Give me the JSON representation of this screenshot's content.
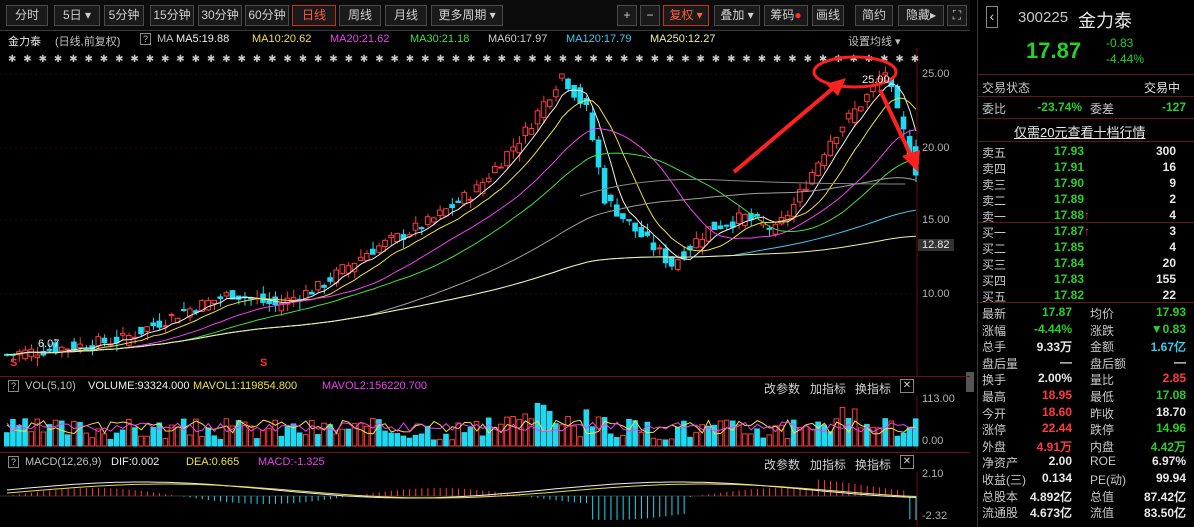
{
  "toolbar": {
    "tabs": [
      "分时",
      "5日",
      "5分钟",
      "15分钟",
      "30分钟",
      "60分钟",
      "日线",
      "周线",
      "月线",
      "更多周期"
    ],
    "active_tab": "日线",
    "plus": "+",
    "minus": "−",
    "fuquan": "复权",
    "diejia": "叠加",
    "chouma": "筹码",
    "huaxian": "画线",
    "jianyue": "简约",
    "yincang": "隐藏"
  },
  "legend": {
    "name": "金力泰",
    "mode": "(日线,前复权)",
    "ma": "MA",
    "ma5": "MA5:19.88",
    "ma10": "MA10:20.62",
    "ma20": "MA20:21.62",
    "ma30": "MA30:21.18",
    "ma60": "MA60:17.97",
    "ma120": "MA120:17.79",
    "ma250": "MA250:12.27",
    "settings": "设置均线"
  },
  "price_axis": [
    "25.00",
    "20.00",
    "15.00",
    "12.82",
    "10.00"
  ],
  "chart_labels": {
    "high": "25.00",
    "low": "6.07"
  },
  "volume": {
    "title": "VOL(5,10)",
    "volume": "VOLUME:93324.000",
    "mavol1": "MAVOL1:119854.800",
    "mavol2": "MAVOL2:156220.700",
    "axis": [
      "113.00",
      "0.00"
    ]
  },
  "macd": {
    "title": "MACD(12,26,9)",
    "dif": "DIF:0.002",
    "dea": "DEA:0.665",
    "macd": "MACD:-1.325",
    "axis": [
      "2.10",
      "-2.32"
    ]
  },
  "panel_buttons": {
    "change": "改参数",
    "add": "加指标",
    "swap": "换指标"
  },
  "quote": {
    "code": "300225",
    "name": "金力泰",
    "price": "17.87",
    "change": "-0.83",
    "pct": "-4.44%",
    "status_label": "交易状态",
    "status": "交易中",
    "weibi_label": "委比",
    "weibi": "-23.74%",
    "weicha_label": "委差",
    "weicha": "-127",
    "link": "仅需20元查看十档行情",
    "sells": [
      {
        "l": "卖五",
        "p": "17.93",
        "v": "300"
      },
      {
        "l": "卖四",
        "p": "17.91",
        "v": "16"
      },
      {
        "l": "卖三",
        "p": "17.90",
        "v": "9"
      },
      {
        "l": "卖二",
        "p": "17.89",
        "v": "2"
      },
      {
        "l": "卖一",
        "p": "17.88",
        "v": "4"
      }
    ],
    "buys": [
      {
        "l": "买一",
        "p": "17.87",
        "v": "3"
      },
      {
        "l": "买二",
        "p": "17.85",
        "v": "4"
      },
      {
        "l": "买三",
        "p": "17.84",
        "v": "20"
      },
      {
        "l": "买四",
        "p": "17.83",
        "v": "155"
      },
      {
        "l": "买五",
        "p": "17.82",
        "v": "22"
      }
    ],
    "stats": [
      {
        "l1": "最新",
        "v1": "17.87",
        "l2": "均价",
        "v2": "17.93"
      },
      {
        "l1": "涨幅",
        "v1": "-4.44%",
        "l2": "涨跌",
        "v2": "▼0.83"
      },
      {
        "l1": "总手",
        "v1": "9.33万",
        "l2": "金额",
        "v2": "1.67亿"
      },
      {
        "l1": "盘后量",
        "v1": "—",
        "l2": "盘后额",
        "v2": "—"
      },
      {
        "l1": "换手",
        "v1": "2.00%",
        "l2": "量比",
        "v2": "2.85"
      },
      {
        "l1": "最高",
        "v1": "18.95",
        "l2": "最低",
        "v2": "17.08"
      },
      {
        "l1": "今开",
        "v1": "18.60",
        "l2": "昨收",
        "v2": "18.70"
      },
      {
        "l1": "涨停",
        "v1": "22.44",
        "l2": "跌停",
        "v2": "14.96"
      },
      {
        "l1": "外盘",
        "v1": "4.91万",
        "l2": "内盘",
        "v2": "4.42万"
      },
      {
        "l1": "净资产",
        "v1": "2.00",
        "l2": "ROE",
        "v2": "6.97%"
      },
      {
        "l1": "收益(三)",
        "v1": "0.134",
        "l2": "PE(动)",
        "v2": "99.94"
      },
      {
        "l1": "总股本",
        "v1": "4.892亿",
        "l2": "总值",
        "v2": "87.42亿"
      },
      {
        "l1": "流通股",
        "v1": "4.673亿",
        "l2": "流值",
        "v2": "83.50亿"
      }
    ]
  }
}
